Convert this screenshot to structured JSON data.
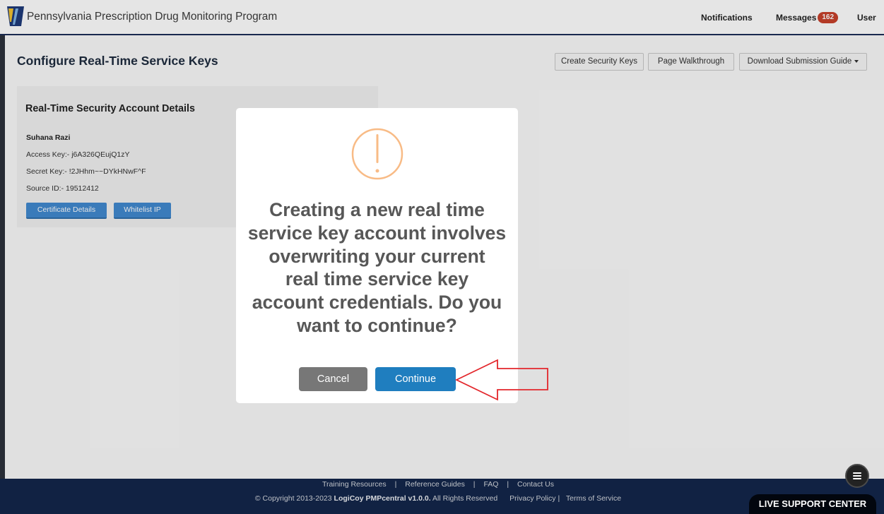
{
  "header": {
    "title": "Pennsylvania Prescription Drug Monitoring Program",
    "nav": {
      "notifications": "Notifications",
      "messages": "Messages",
      "messages_count": "162",
      "user": "User"
    }
  },
  "page": {
    "title": "Configure Real-Time Service Keys",
    "actions": {
      "create_security_keys": "Create Security Keys",
      "page_walkthrough": "Page Walkthrough",
      "download_submission_guide": "Download Submission Guide"
    }
  },
  "account_card": {
    "title": "Real-Time Security Account Details",
    "name": "Suhana Razi",
    "fields": [
      {
        "label": "Access Key:-",
        "value": "j6A326QEujQ1zY"
      },
      {
        "label": "Secret Key:-",
        "value": "!2JHhm~~DYkHNwF^F"
      },
      {
        "label": "Source ID:-",
        "value": "19512412"
      }
    ],
    "buttons": {
      "certificate_details": "Certificate Details",
      "whitelist_ip": "Whitelist IP"
    }
  },
  "modal": {
    "message_lines": [
      "Creating a new real time",
      "service key account involves",
      "overwriting your current",
      "real time service key",
      "account credentials. Do you",
      "want to continue?"
    ],
    "cancel_label": "Cancel",
    "continue_label": "Continue"
  },
  "footer": {
    "links": [
      "Training Resources",
      "Reference Guides",
      "FAQ",
      "Contact Us"
    ],
    "separator": "|",
    "copyright_prefix": "© Copyright 2013-2023",
    "copyright_brand": "LogiCoy PMPcentral v1.0.0.",
    "copyright_suffix": "All Rights Reserved",
    "privacy_policy": "Privacy Policy",
    "terms_of_service": "Terms of Service",
    "live_support": "LIVE SUPPORT CENTER"
  },
  "icons": {
    "logo": "pa-keystone-logo",
    "download_caret": "caret-down-icon",
    "modal_alert": "exclamation-circle-icon",
    "annotation": "arrow-left-outline-icon",
    "chat_widget": "menu-icon"
  },
  "colors": {
    "brand_navy": "#1b2d57",
    "primary_blue": "#1f7ebf",
    "badge_red": "#c8412b",
    "warning_orange": "#f8bb86",
    "cancel_gray": "#777777",
    "annotation_red": "#e3262b",
    "footer_navy": "#14264b"
  }
}
